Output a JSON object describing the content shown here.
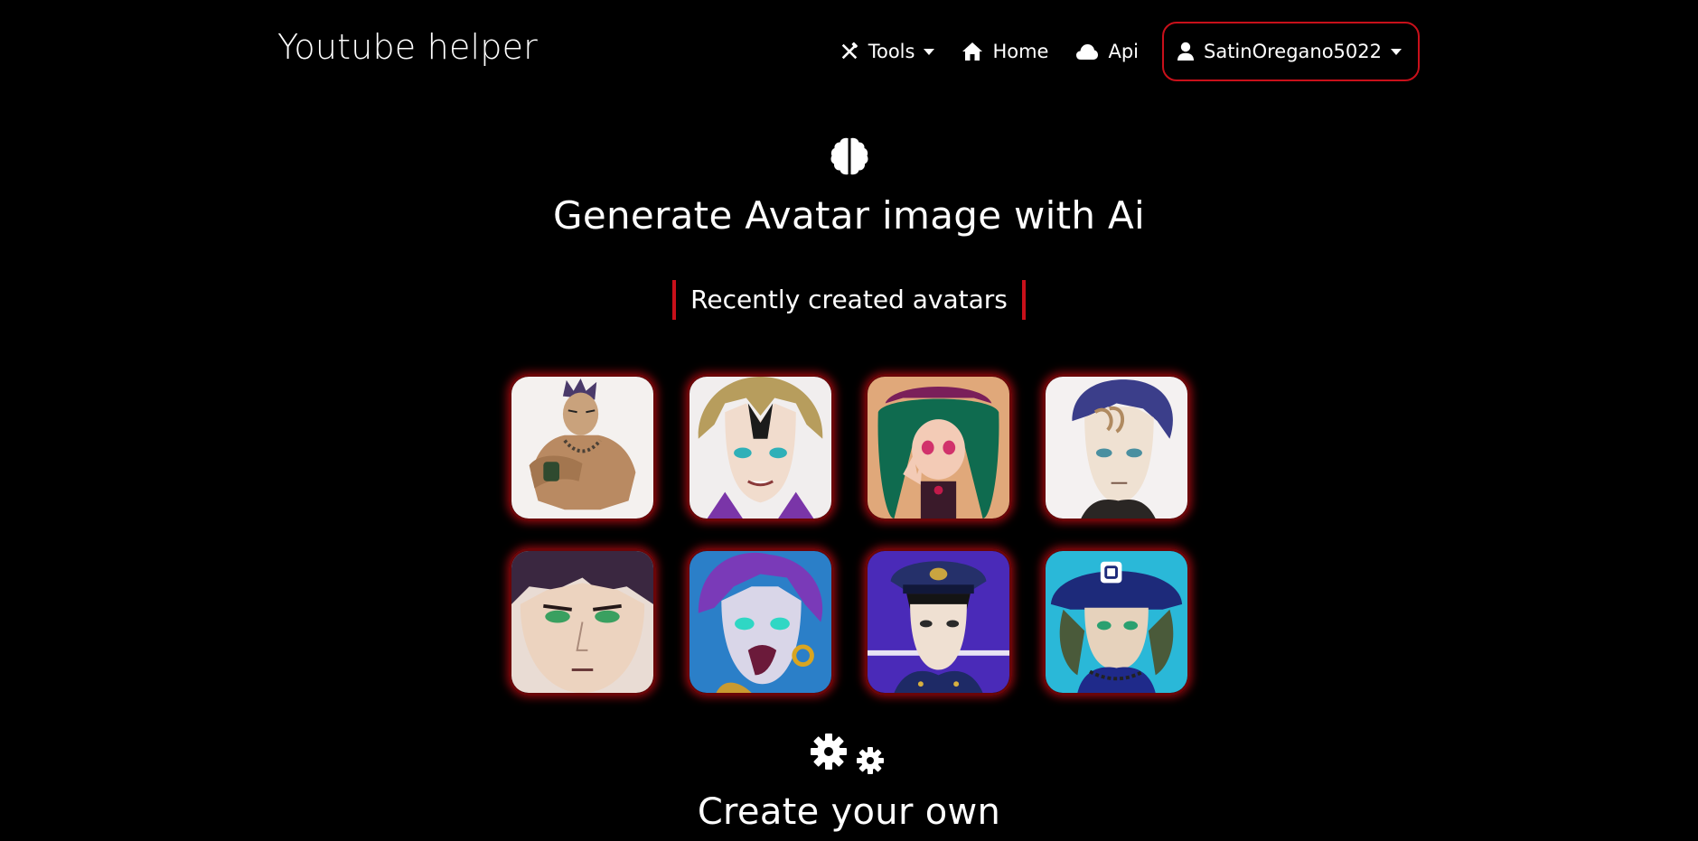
{
  "app": {
    "brand": "Youtube helper"
  },
  "nav": {
    "tools_label": "Tools",
    "home_label": "Home",
    "api_label": "Api",
    "user_label": "SatinOregano5022"
  },
  "hero": {
    "title": "Generate Avatar image with Ai"
  },
  "recent": {
    "label": "Recently created avatars",
    "avatars": [
      {
        "name": "avatar-1"
      },
      {
        "name": "avatar-2"
      },
      {
        "name": "avatar-3"
      },
      {
        "name": "avatar-4"
      },
      {
        "name": "avatar-5"
      },
      {
        "name": "avatar-6"
      },
      {
        "name": "avatar-7"
      },
      {
        "name": "avatar-8"
      }
    ]
  },
  "create": {
    "title": "Create your own"
  },
  "colors": {
    "accent": "#c8101a",
    "background": "#000000",
    "text": "#ffffff"
  },
  "icons": {
    "tools": "tools-icon",
    "home": "home-icon",
    "api": "cloud-icon",
    "user": "user-icon",
    "hero": "brain-icon",
    "create": "gears-icon"
  }
}
